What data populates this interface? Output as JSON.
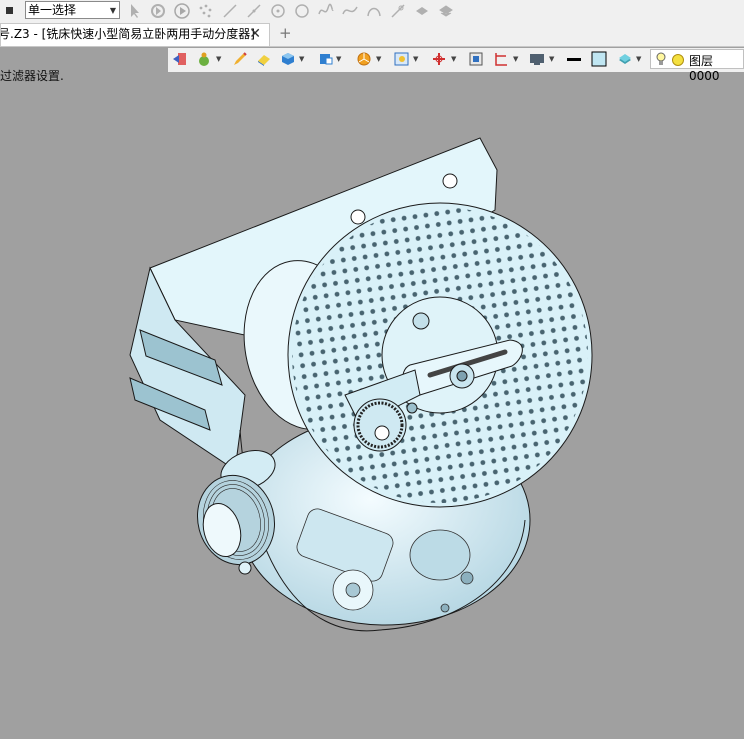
{
  "toolbar": {
    "selection_filter": "单一选择",
    "icons": [
      "stop-icon",
      "cursor-icon",
      "select-pattern-icon",
      "play-icon",
      "point-cloud-icon",
      "line-icon",
      "arc-line-icon",
      "circle-center-icon",
      "circle-icon",
      "spline-icon",
      "curve-icon",
      "arc-icon",
      "tangent-line-icon",
      "hand-icon",
      "hand-drag-icon"
    ]
  },
  "tab": {
    "title": "号.Z3 - [铣床快速小型简易立卧两用手动分度器]",
    "close": "✕",
    "add": "+"
  },
  "view_toolbar": {
    "layer_label": "图层0000",
    "icons": [
      "exit-icon",
      "render-icon",
      "pencil-icon",
      "eraser-icon",
      "cube-icon",
      "view-cube-icon",
      "pie-icon",
      "zoom-view-icon",
      "axis-icon",
      "fit-icon",
      "section-icon",
      "display-icon",
      "line-color-icon",
      "fill-color-icon",
      "layer-filter-icon",
      "bulb-icon",
      "sun-icon"
    ]
  },
  "hint_text": "过滤器设置.",
  "colors": {
    "background": "#a0a0a0",
    "model_fill": "#d8f1f8",
    "model_edge": "#1a1a1a"
  }
}
